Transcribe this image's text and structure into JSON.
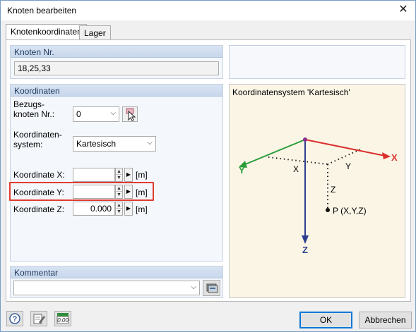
{
  "window": {
    "title": "Knoten bearbeiten"
  },
  "tabs": [
    {
      "label": "Knotenkoordinaten",
      "active": true
    },
    {
      "label": "Lager",
      "active": false
    }
  ],
  "knoten": {
    "header": "Knoten Nr.",
    "value": "18,25,33"
  },
  "koordinaten": {
    "header": "Koordinaten",
    "bezugsknoten_label_1": "Bezugs-",
    "bezugsknoten_label_2": "knoten Nr.:",
    "bezugsknoten_value": "0",
    "system_label_1": "Koordinaten-",
    "system_label_2": "system:",
    "system_value": "Kartesisch",
    "x_label": "Koordinate X:",
    "x_value": "",
    "y_label": "Koordinate Y:",
    "y_value": "",
    "z_label": "Koordinate Z:",
    "z_value": "0.000",
    "unit": "[m]"
  },
  "kommentar": {
    "header": "Kommentar",
    "value": ""
  },
  "diagram": {
    "title": "Koordinatensystem 'Kartesisch'",
    "axis_x": "X",
    "axis_y": "Y",
    "axis_z": "Z",
    "proj_x": "X",
    "proj_y": "Y",
    "proj_z": "Z",
    "point": "P (X,Y,Z)",
    "colors": {
      "x": "#d9302b",
      "y": "#2a9d3a",
      "z": "#2d3f8f",
      "highlight": "#e03c31",
      "origin": "#8a2f8f"
    }
  },
  "footer": {
    "ok": "OK",
    "cancel": "Abbrechen",
    "icons": [
      "help-icon",
      "edit-icon",
      "calculator-icon"
    ]
  }
}
